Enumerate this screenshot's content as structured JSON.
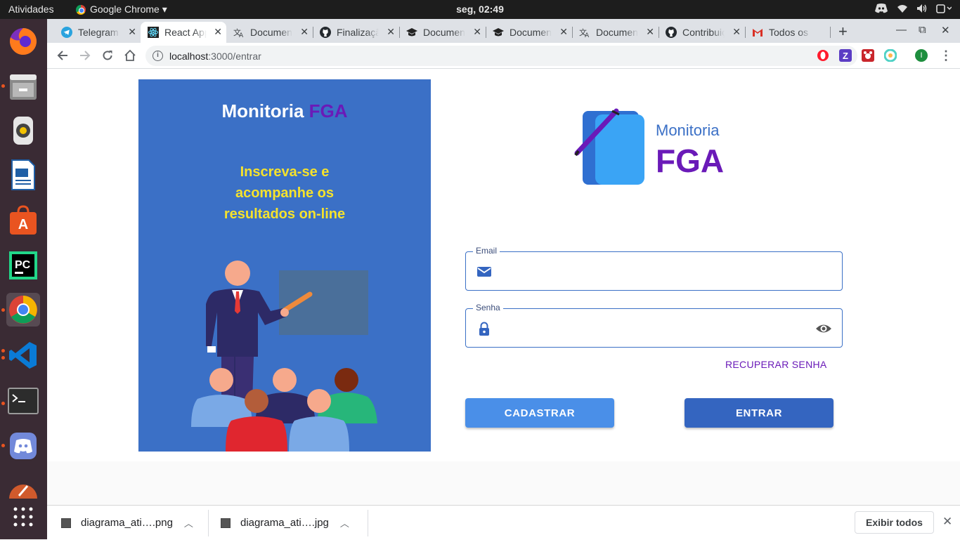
{
  "topbar": {
    "activities": "Atividades",
    "app_name": "Google Chrome ▾",
    "clock": "seg, 02:49"
  },
  "dock": {
    "items": [
      "firefox-icon",
      "files-icon",
      "rhythmbox-icon",
      "libreoffice-writer-icon",
      "software-center-icon",
      "pycharm-icon",
      "chrome-icon",
      "vscode-icon",
      "terminal-icon",
      "discord-icon",
      "inkscape-icon",
      "app-grid-icon"
    ]
  },
  "tabs": [
    {
      "label": "Telegram",
      "icon": "telegram-icon"
    },
    {
      "label": "React App",
      "icon": "react-icon"
    },
    {
      "label": "Documentação",
      "icon": "translate-icon"
    },
    {
      "label": "Finalização",
      "icon": "github-icon"
    },
    {
      "label": "Documentação",
      "icon": "graduation-cap-icon"
    },
    {
      "label": "Documentação",
      "icon": "graduation-cap-icon"
    },
    {
      "label": "Documentação",
      "icon": "translate-icon"
    },
    {
      "label": "Contribuição",
      "icon": "github-icon"
    },
    {
      "label": "Todos os",
      "icon": "gmail-icon"
    }
  ],
  "toolbar": {
    "url_host": "localhost",
    "url_path": ":3000/entrar",
    "profile_initial": "I"
  },
  "left_panel": {
    "title_a": "Monitoria",
    "title_b": "FGA",
    "subtitle": "Inscreva-se e acompanhe os resultados on-line"
  },
  "logo": {
    "word1": "Monitoria",
    "word2": "FGA"
  },
  "form": {
    "email_label": "Email",
    "email_value": "",
    "password_label": "Senha",
    "password_value": "",
    "recover_label": "RECUPERAR SENHA",
    "register_label": "CADASTRAR",
    "login_label": "ENTRAR"
  },
  "downloads": {
    "items": [
      "diagrama_ati….png",
      "diagrama_ati….jpg"
    ],
    "show_all": "Exibir todos"
  },
  "colors": {
    "panel_blue": "#3b70c6",
    "accent_purple": "#6a1ab8",
    "subtitle_yellow": "#f5e22c",
    "register_button": "#4a8fe8",
    "login_button": "#3465c0"
  }
}
